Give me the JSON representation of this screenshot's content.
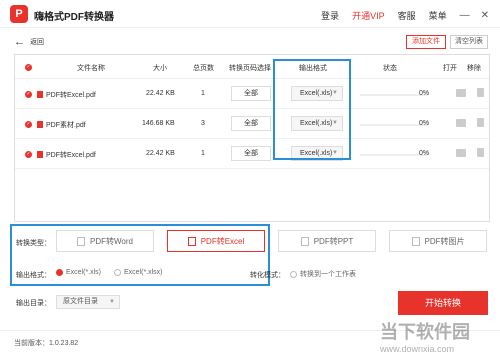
{
  "app": {
    "title": "嗨格式PDF转换器",
    "logo_letter": "P"
  },
  "top_menu": {
    "login": "登录",
    "vip": "开通VIP",
    "service": "客服",
    "menu": "菜单"
  },
  "nav": {
    "back": "返回",
    "add_file": "添加文件",
    "clear_list": "清空列表"
  },
  "table": {
    "headers": {
      "name": "文件名称",
      "size": "大小",
      "pages": "总页数",
      "page_select": "转换页码选择",
      "format": "输出格式",
      "status": "状态",
      "open": "打开",
      "remove": "移除"
    },
    "rows": [
      {
        "name": "PDF转Excel.pdf",
        "size": "22.42 KB",
        "pages": "1",
        "page_select": "全部",
        "format": "Excel(.xls)",
        "progress": "0%"
      },
      {
        "name": "PDF素材.pdf",
        "size": "146.68 KB",
        "pages": "3",
        "page_select": "全部",
        "format": "Excel(.xls)",
        "progress": "0%"
      },
      {
        "name": "PDF转Excel.pdf",
        "size": "22.42 KB",
        "pages": "1",
        "page_select": "全部",
        "format": "Excel(.xls)",
        "progress": "0%"
      }
    ]
  },
  "options": {
    "type_label": "转换类型：",
    "types": [
      "PDF转Word",
      "PDF转Excel",
      "PDF转PPT",
      "PDF转图片"
    ],
    "active_type_index": 1,
    "format_label": "输出格式：",
    "formats": [
      "Excel(*.xls)",
      "Excel(*.xlsx)"
    ],
    "selected_format_index": 0,
    "convert_mode_label": "转化模式：",
    "convert_mode_option": "转换到一个工作表"
  },
  "output": {
    "dir_label": "输出目录：",
    "dir_value": "原文件目录",
    "start": "开始转换"
  },
  "footer": {
    "version": "当前版本：1.0.23.82"
  },
  "watermark": {
    "line1": "当下软件园",
    "line2": "www.downxia.com"
  },
  "colors": {
    "accent": "#e8322c",
    "highlight": "#2a8fd6"
  }
}
